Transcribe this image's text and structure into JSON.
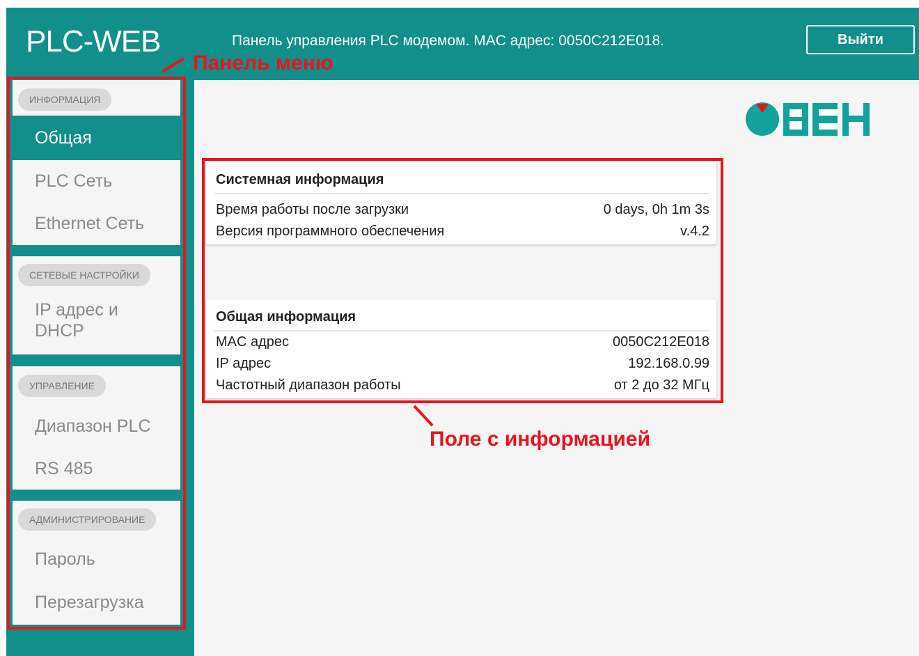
{
  "header": {
    "logo_text": "PLC-WEB",
    "info_text": "Панель управления PLC модемом. MAC адрес: 0050C212E018.",
    "logout_label": "Выйти"
  },
  "sidebar": {
    "groups": [
      {
        "label": "ИНФОРМАЦИЯ",
        "items": [
          {
            "label": "Общая",
            "active": true
          },
          {
            "label": "PLC Сеть"
          },
          {
            "label": "Ethernet Сеть"
          }
        ]
      },
      {
        "label": "СЕТЕВЫЕ НАСТРОЙКИ",
        "items": [
          {
            "label": "IP адрес и",
            "label2": "DHCP"
          }
        ]
      },
      {
        "label": "УПРАВЛЕНИЕ",
        "items": [
          {
            "label": "Диапазон PLC"
          },
          {
            "label": "RS 485"
          }
        ]
      },
      {
        "label": "АДМИНИСТРИРОВАНИЕ",
        "items": [
          {
            "label": "Пароль"
          },
          {
            "label": "Перезагрузка"
          }
        ]
      }
    ]
  },
  "annotations": {
    "menu_panel": "Панель меню",
    "info_field": "Поле с информацией"
  },
  "info": {
    "system": {
      "title": "Системная информация",
      "rows": [
        {
          "key": "Время работы после загрузки",
          "value": "0 days, 0h 1m 3s"
        },
        {
          "key": "Версия программного обеспечения",
          "value": "v.4.2"
        }
      ]
    },
    "general": {
      "title": "Общая информация",
      "rows": [
        {
          "key": "MAC адрес",
          "value": "0050C212E018"
        },
        {
          "key": "IP адрес",
          "value": "192.168.0.99"
        },
        {
          "key": "Частотный диапазон работы",
          "value": "от 2 до 32 МГц"
        }
      ]
    }
  },
  "brand": {
    "logo_icon": "oven-logo-icon",
    "logo_color": "#13a19b",
    "accent_color": "#e8151c"
  },
  "colors": {
    "theme": "#128f8b",
    "panel": "#f5f5f5",
    "annotation": "#e8151c"
  }
}
